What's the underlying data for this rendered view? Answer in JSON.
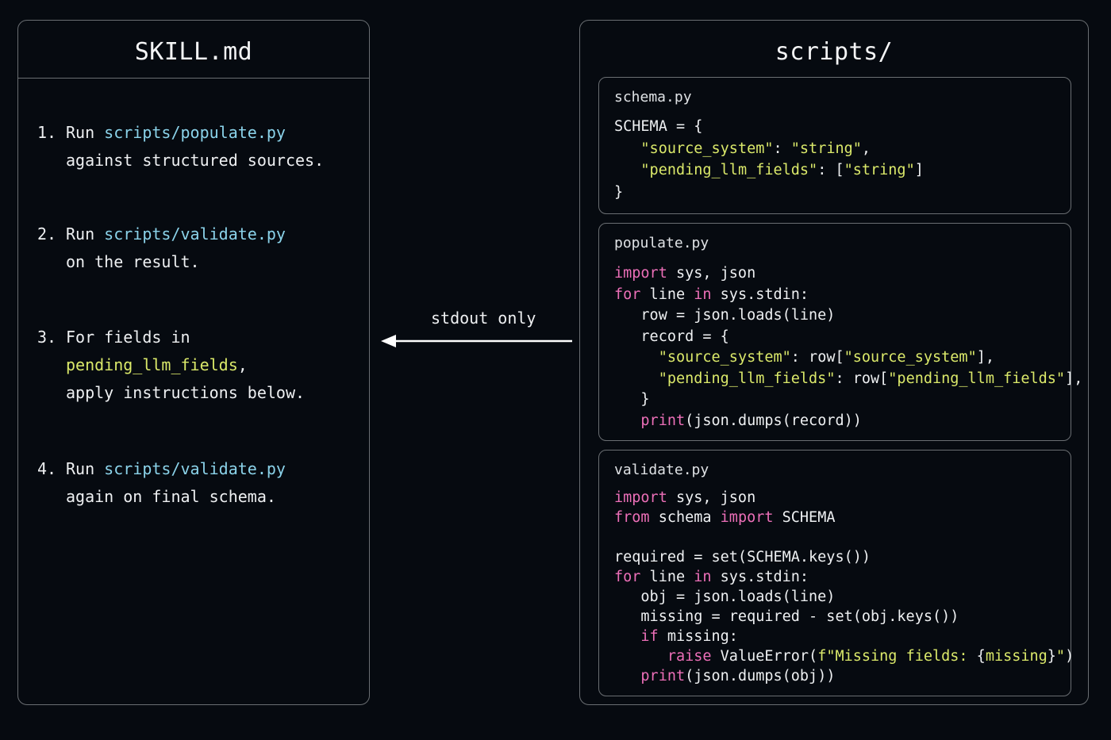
{
  "skill_panel": {
    "title": "SKILL.md",
    "steps": [
      {
        "number": "1.",
        "lines": [
          [
            {
              "text": "Run ",
              "style": "white"
            },
            {
              "text": "scripts/populate.py",
              "style": "cyan"
            }
          ],
          [
            {
              "text": "against structured sources.",
              "style": "white"
            }
          ]
        ]
      },
      {
        "number": "2.",
        "lines": [
          [
            {
              "text": "Run ",
              "style": "white"
            },
            {
              "text": "scripts/validate.py",
              "style": "cyan"
            }
          ],
          [
            {
              "text": "on the result.",
              "style": "white"
            }
          ]
        ]
      },
      {
        "number": "3.",
        "lines": [
          [
            {
              "text": "For fields in",
              "style": "white"
            }
          ],
          [
            {
              "text": "pending_llm_fields",
              "style": "green"
            },
            {
              "text": ",",
              "style": "white"
            }
          ],
          [
            {
              "text": "apply instructions below.",
              "style": "white"
            }
          ]
        ]
      },
      {
        "number": "4.",
        "lines": [
          [
            {
              "text": "Run ",
              "style": "white"
            },
            {
              "text": "scripts/validate.py",
              "style": "cyan"
            }
          ],
          [
            {
              "text": "again on final schema.",
              "style": "white"
            }
          ]
        ]
      }
    ]
  },
  "arrow": {
    "label": "stdout only",
    "direction": "left"
  },
  "scripts_panel": {
    "title": "scripts/",
    "files": [
      {
        "name": "schema.py",
        "lines": [
          [
            {
              "text": "SCHEMA = {",
              "style": "white"
            }
          ],
          [
            {
              "text": "   ",
              "style": "white"
            },
            {
              "text": "\"source_system\"",
              "style": "green"
            },
            {
              "text": ": ",
              "style": "white"
            },
            {
              "text": "\"string\"",
              "style": "green"
            },
            {
              "text": ",",
              "style": "white"
            }
          ],
          [
            {
              "text": "   ",
              "style": "white"
            },
            {
              "text": "\"pending_llm_fields\"",
              "style": "green"
            },
            {
              "text": ": [",
              "style": "white"
            },
            {
              "text": "\"string\"",
              "style": "green"
            },
            {
              "text": "]",
              "style": "white"
            }
          ],
          [
            {
              "text": "}",
              "style": "white"
            }
          ]
        ]
      },
      {
        "name": "populate.py",
        "lines": [
          [
            {
              "text": "import",
              "style": "pink"
            },
            {
              "text": " sys, json",
              "style": "white"
            }
          ],
          [
            {
              "text": "for",
              "style": "pink"
            },
            {
              "text": " line ",
              "style": "white"
            },
            {
              "text": "in",
              "style": "pink"
            },
            {
              "text": " sys.stdin:",
              "style": "white"
            }
          ],
          [
            {
              "text": "   row = json.loads(line)",
              "style": "white"
            }
          ],
          [
            {
              "text": "   record = {",
              "style": "white"
            }
          ],
          [
            {
              "text": "     ",
              "style": "white"
            },
            {
              "text": "\"source_system\"",
              "style": "green"
            },
            {
              "text": ": row[",
              "style": "white"
            },
            {
              "text": "\"source_system\"",
              "style": "green"
            },
            {
              "text": "],",
              "style": "white"
            }
          ],
          [
            {
              "text": "     ",
              "style": "white"
            },
            {
              "text": "\"pending_llm_fields\"",
              "style": "green"
            },
            {
              "text": ": row[",
              "style": "white"
            },
            {
              "text": "\"pending_llm_fields\"",
              "style": "green"
            },
            {
              "text": "],",
              "style": "white"
            }
          ],
          [
            {
              "text": "   }",
              "style": "white"
            }
          ],
          [
            {
              "text": "   ",
              "style": "white"
            },
            {
              "text": "print",
              "style": "pink"
            },
            {
              "text": "(json.dumps(record))",
              "style": "white"
            }
          ]
        ]
      },
      {
        "name": "validate.py",
        "lines": [
          [
            {
              "text": "import",
              "style": "pink"
            },
            {
              "text": " sys, json",
              "style": "white"
            }
          ],
          [
            {
              "text": "from",
              "style": "pink"
            },
            {
              "text": " schema ",
              "style": "white"
            },
            {
              "text": "import",
              "style": "pink"
            },
            {
              "text": " SCHEMA",
              "style": "white"
            }
          ],
          [
            {
              "text": "",
              "style": "white"
            }
          ],
          [
            {
              "text": "required = set(SCHEMA.keys())",
              "style": "white"
            }
          ],
          [
            {
              "text": "for",
              "style": "pink"
            },
            {
              "text": " line ",
              "style": "white"
            },
            {
              "text": "in",
              "style": "pink"
            },
            {
              "text": " sys.stdin:",
              "style": "white"
            }
          ],
          [
            {
              "text": "   obj = json.loads(line)",
              "style": "white"
            }
          ],
          [
            {
              "text": "   missing = required - set(obj.keys())",
              "style": "white"
            }
          ],
          [
            {
              "text": "   ",
              "style": "white"
            },
            {
              "text": "if",
              "style": "pink"
            },
            {
              "text": " missing:",
              "style": "white"
            }
          ],
          [
            {
              "text": "      ",
              "style": "white"
            },
            {
              "text": "raise",
              "style": "pink"
            },
            {
              "text": " ValueError(",
              "style": "white"
            },
            {
              "text": "f\"Missing fields: ",
              "style": "green"
            },
            {
              "text": "{",
              "style": "white"
            },
            {
              "text": "missing",
              "style": "green"
            },
            {
              "text": "}",
              "style": "white"
            },
            {
              "text": "\"",
              "style": "green"
            },
            {
              "text": ")",
              "style": "white"
            }
          ],
          [
            {
              "text": "   ",
              "style": "white"
            },
            {
              "text": "print",
              "style": "pink"
            },
            {
              "text": "(json.dumps(obj))",
              "style": "white"
            }
          ]
        ]
      }
    ]
  },
  "colors": {
    "background": "#060a10",
    "border": "#6a6e72",
    "text": "#eef0f2",
    "path_cyan": "#8bd3ea",
    "string_green": "#dbe96a",
    "keyword_pink": "#ec6fb8"
  }
}
